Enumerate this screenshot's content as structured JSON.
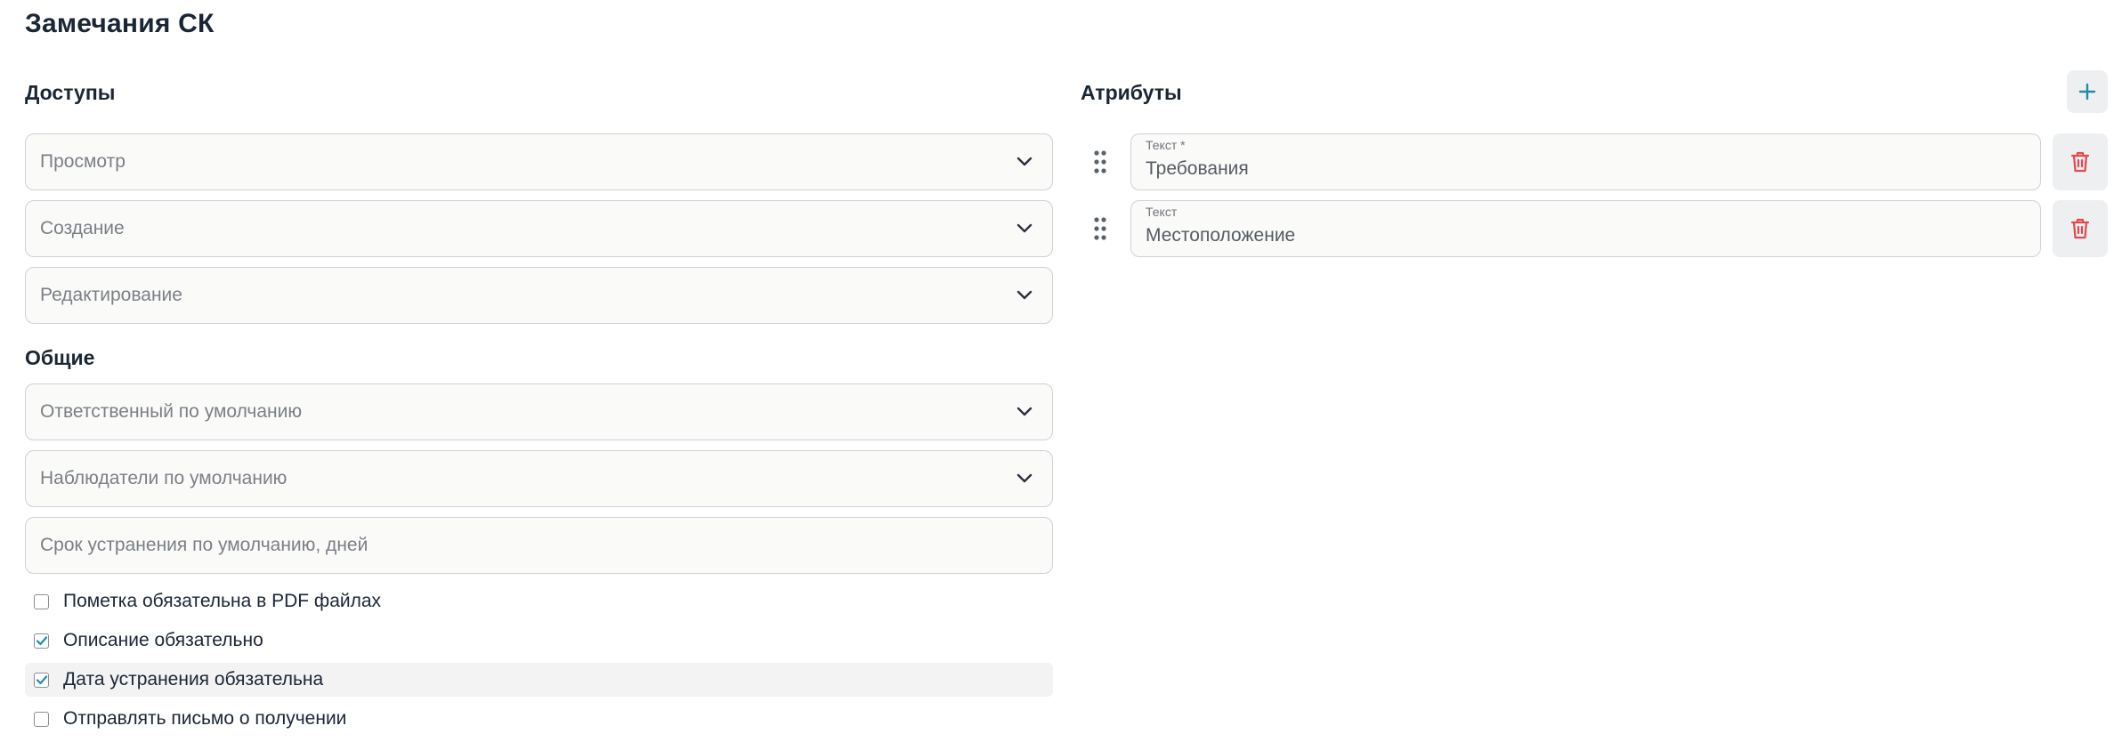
{
  "title": "Замечания СК",
  "access": {
    "heading": "Доступы",
    "selects": [
      {
        "placeholder": "Просмотр"
      },
      {
        "placeholder": "Создание"
      },
      {
        "placeholder": "Редактирование"
      }
    ]
  },
  "general": {
    "heading": "Общие",
    "responsible_placeholder": "Ответственный по умолчанию",
    "observers_placeholder": "Наблюдатели по умолчанию",
    "deadline_placeholder": "Срок устранения по умолчанию, дней",
    "checkboxes": [
      {
        "label": "Пометка обязательна в PDF файлах",
        "checked": false
      },
      {
        "label": "Описание обязательно",
        "checked": true
      },
      {
        "label": "Дата устранения обязательна",
        "checked": true
      },
      {
        "label": "Отправлять письмо о получении",
        "checked": false
      }
    ]
  },
  "attributes": {
    "heading": "Атрибуты",
    "items": [
      {
        "type_label": "Текст *",
        "value": "Требования"
      },
      {
        "type_label": "Текст",
        "value": "Местоположение"
      }
    ]
  },
  "icons": {
    "select_chevron": "chevron-down-icon",
    "drag": "drag-handle-icon",
    "delete": "trash-icon",
    "add": "plus-icon"
  },
  "colors": {
    "accent": "#1a8fa6",
    "danger": "#e5484d",
    "text": "#1b2635",
    "placeholder": "#7b7f86",
    "field_bg": "#fafaf8",
    "field_border": "#cfd1d6",
    "button_bg": "#eeeff1"
  }
}
